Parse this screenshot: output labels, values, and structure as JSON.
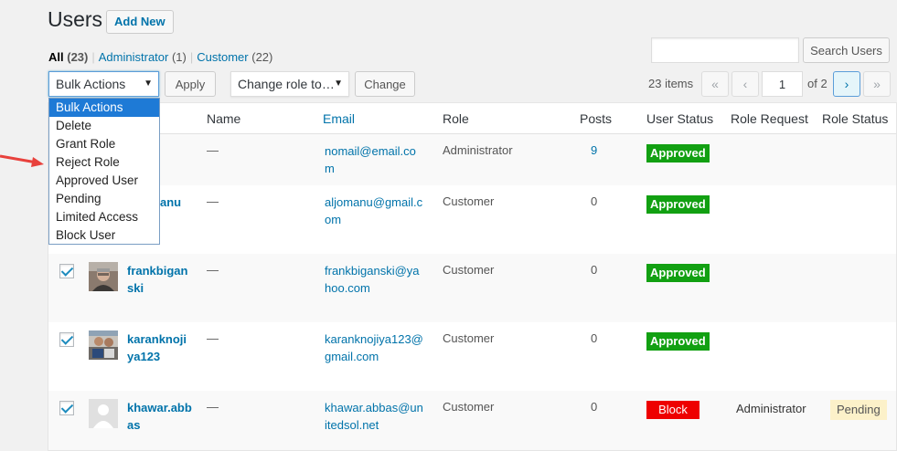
{
  "page": {
    "title": "Users",
    "add_new_label": "Add New"
  },
  "views": {
    "all": {
      "label": "All",
      "count": "(23)"
    },
    "administrator": {
      "label": "Administrator",
      "count": "(1)"
    },
    "customer": {
      "label": "Customer",
      "count": "(22)"
    },
    "separator": "|"
  },
  "search": {
    "value": "",
    "button_label": "Search Users"
  },
  "bulk": {
    "selected": "Bulk Actions",
    "apply_label": "Apply",
    "options": [
      "Bulk Actions",
      "Delete",
      "Grant Role",
      "Reject Role",
      "Approved User",
      "Pending",
      "Limited Access",
      "Block User"
    ]
  },
  "role_change": {
    "selected": "Change role to…",
    "button_label": "Change"
  },
  "pagination": {
    "items": "23 items",
    "first": "«",
    "prev": "‹",
    "current": "1",
    "of": "of 2",
    "next": "›",
    "last": "»"
  },
  "columns": {
    "name": "Name",
    "email": "Email",
    "role": "Role",
    "posts": "Posts",
    "user_status": "User Status",
    "role_request": "Role Request",
    "role_status": "Role Status"
  },
  "rows": [
    {
      "username": "",
      "name": "—",
      "email": "nomail@email.com",
      "role": "Administrator",
      "posts": "9",
      "user_status": "Approved",
      "role_request": "",
      "role_status": ""
    },
    {
      "username": "anu",
      "name": "—",
      "email": "aljomanu@gmail.com",
      "role": "Customer",
      "posts": "0",
      "user_status": "Approved",
      "role_request": "",
      "role_status": ""
    },
    {
      "username": "frankbiganski",
      "name": "—",
      "email": "frankbiganski@yahoo.com",
      "role": "Customer",
      "posts": "0",
      "user_status": "Approved",
      "role_request": "",
      "role_status": ""
    },
    {
      "username": "karanknojiya123",
      "name": "—",
      "email": "karanknojiya123@gmail.com",
      "role": "Customer",
      "posts": "0",
      "user_status": "Approved",
      "role_request": "",
      "role_status": ""
    },
    {
      "username": "khawar.abbas",
      "name": "—",
      "email": "khawar.abbas@unitedsol.net",
      "role": "Customer",
      "posts": "0",
      "user_status": "Block",
      "role_request": "Administrator",
      "role_status": "Pending"
    }
  ],
  "colors": {
    "accent": "#0073aa",
    "approved": "#12a012",
    "block": "#ee0000",
    "pending_bg": "#fcf1c9",
    "arrow": "#e8413c"
  }
}
